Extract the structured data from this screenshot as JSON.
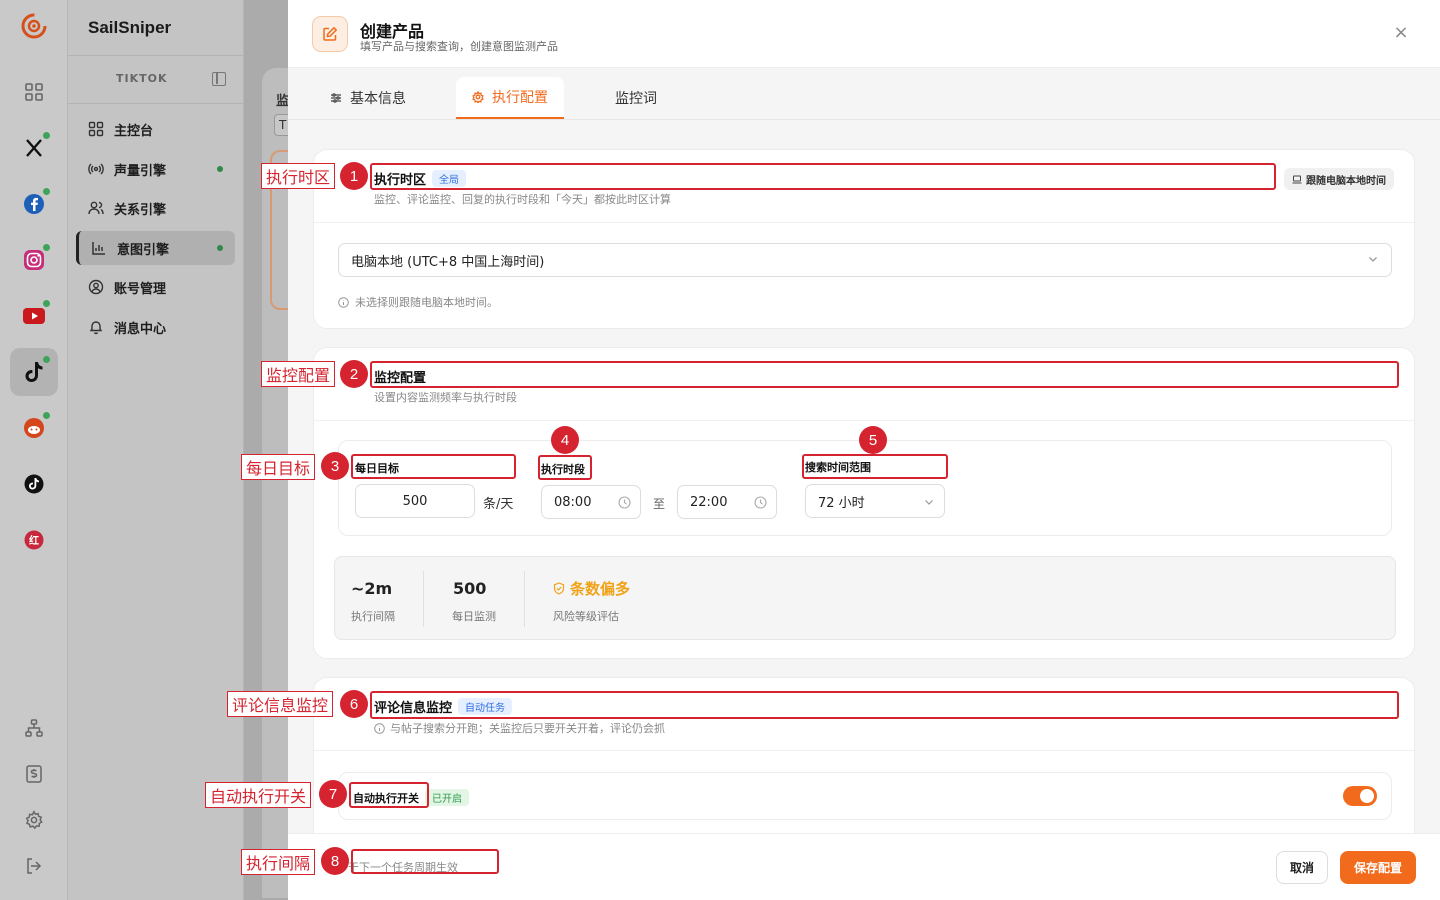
{
  "app": {
    "brand": "SailSniper",
    "platform_label": "TIKTOK",
    "nav": [
      {
        "label": "主控台",
        "icon": "dashboard-icon",
        "dot": false,
        "active": false
      },
      {
        "label": "声量引擎",
        "icon": "broadcast-icon",
        "dot": true,
        "active": false
      },
      {
        "label": "关系引擎",
        "icon": "users-icon",
        "dot": false,
        "active": false
      },
      {
        "label": "意图引擎",
        "icon": "chart-icon",
        "dot": true,
        "active": true
      },
      {
        "label": "账号管理",
        "icon": "account-icon",
        "dot": false,
        "active": false
      },
      {
        "label": "消息中心",
        "icon": "bell-icon",
        "dot": false,
        "active": false
      }
    ],
    "background_text": "监",
    "background_box": "T"
  },
  "drawer": {
    "title": "创建产品",
    "subtitle": "填写产品与搜索查询，创建意图监测产品",
    "close_symbol": "×",
    "tabs": [
      "基本信息",
      "执行配置",
      "监控词"
    ],
    "active_tab": 1
  },
  "timezone": {
    "title": "执行时区",
    "badge": "全局",
    "desc": "监控、评论监控、回复的执行时段和「今天」都按此时区计算",
    "follow_button": "跟随电脑本地时间",
    "selected": "电脑本地 (UTC+8 中国上海时间)",
    "hint": "未选择则跟随电脑本地时间。"
  },
  "monitor": {
    "title": "监控配置",
    "desc": "设置内容监测频率与执行时段",
    "daily_target_label": "每日目标",
    "daily_target_value": "500",
    "daily_target_unit": "条/天",
    "exec_period_label": "执行时段",
    "start_time": "08:00",
    "to_label": "至",
    "end_time": "22:00",
    "search_range_label": "搜索时间范围",
    "search_range_value": "72 小时",
    "stats": {
      "interval_value": "~2m",
      "interval_label": "执行间隔",
      "daily_value": "500",
      "daily_label": "每日监测",
      "risk_value": "条数偏多",
      "risk_label": "风险等级评估"
    }
  },
  "comment": {
    "title": "评论信息监控",
    "badge": "自动任务",
    "desc": "与帖子搜索分开跑；关监控后只要开关开着，评论仍会抓",
    "switch_label": "自动执行开关",
    "switch_badge": "已开启",
    "switch_on": true
  },
  "footer": {
    "note": "于下一个任务周期生效",
    "cancel": "取消",
    "save": "保存配置"
  },
  "annotations": [
    {
      "num": "1",
      "label": "执行时区"
    },
    {
      "num": "2",
      "label": "监控配置"
    },
    {
      "num": "3",
      "label": "每日目标"
    },
    {
      "num": "4",
      "label": ""
    },
    {
      "num": "5",
      "label": ""
    },
    {
      "num": "6",
      "label": "评论信息监控"
    },
    {
      "num": "7",
      "label": "自动执行开关"
    },
    {
      "num": "8",
      "label": "执行间隔"
    }
  ],
  "colors": {
    "accent": "#f26b1d",
    "annotation": "#d5232f",
    "warning": "#f0a318"
  }
}
